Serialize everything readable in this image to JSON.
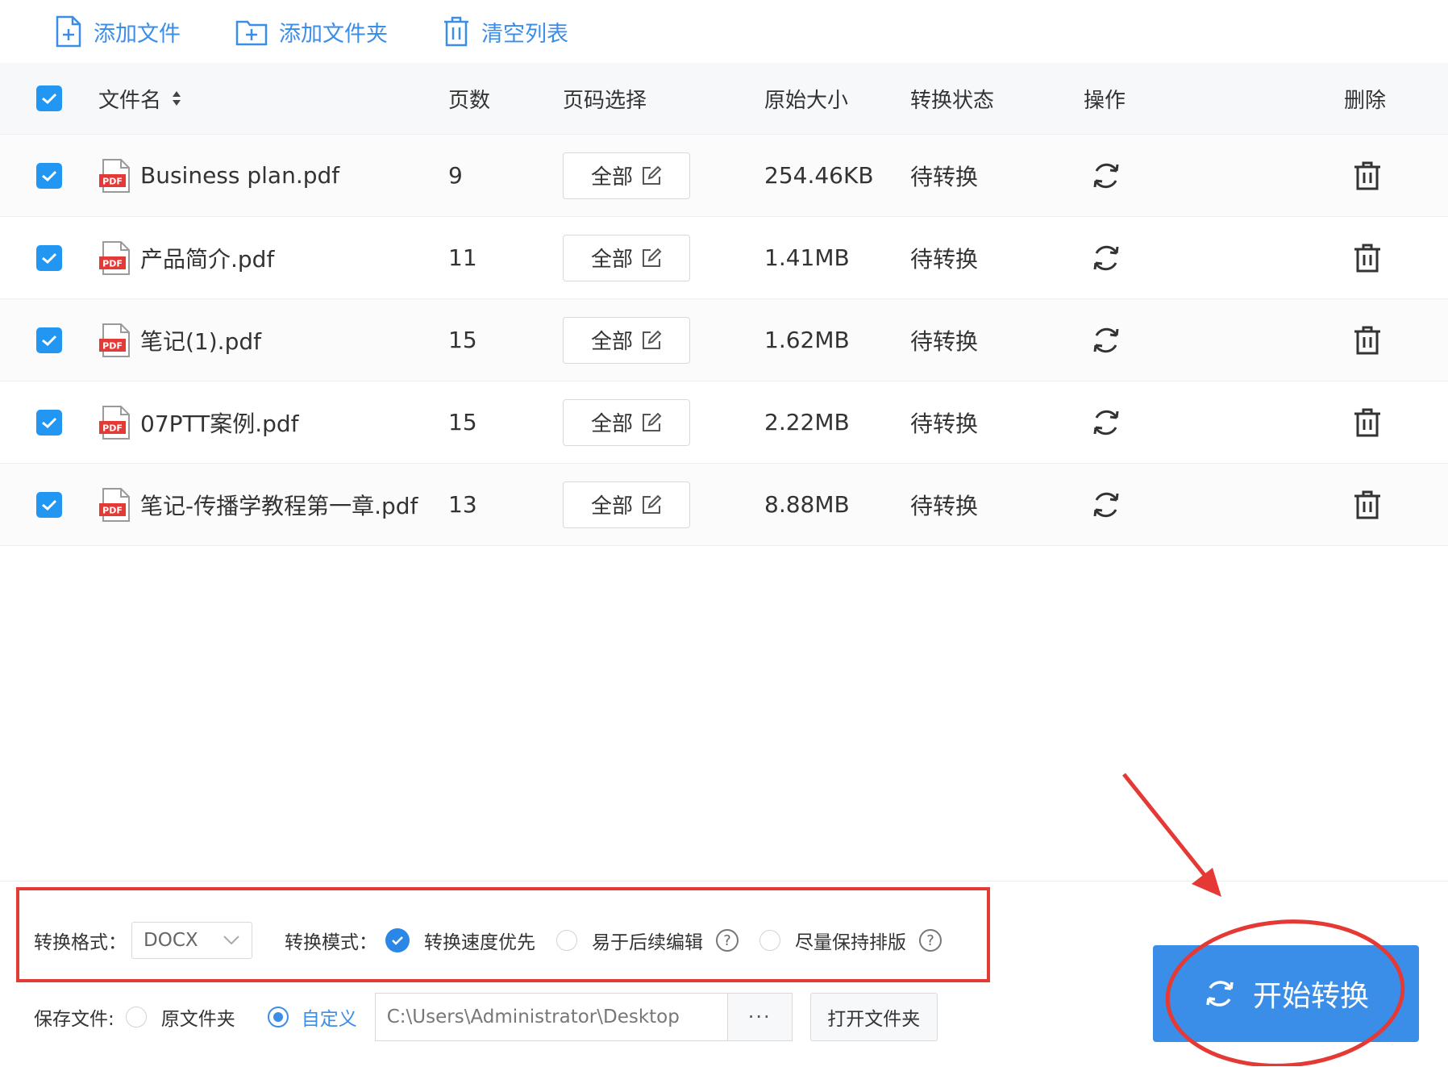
{
  "toolbar": {
    "add_file": "添加文件",
    "add_folder": "添加文件夹",
    "clear_list": "清空列表"
  },
  "table": {
    "headers": {
      "filename": "文件名",
      "pages": "页数",
      "page_select": "页码选择",
      "size": "原始大小",
      "status": "转换状态",
      "action": "操作",
      "delete": "删除"
    },
    "rows": [
      {
        "name": "Business plan.pdf",
        "pages": "9",
        "range": "全部",
        "size": "254.46KB",
        "status": "待转换"
      },
      {
        "name": "产品简介.pdf",
        "pages": "11",
        "range": "全部",
        "size": "1.41MB",
        "status": "待转换"
      },
      {
        "name": "笔记(1).pdf",
        "pages": "15",
        "range": "全部",
        "size": "1.62MB",
        "status": "待转换"
      },
      {
        "name": "07PTT案例.pdf",
        "pages": "15",
        "range": "全部",
        "size": "2.22MB",
        "status": "待转换"
      },
      {
        "name": "笔记-传播学教程第一章.pdf",
        "pages": "13",
        "range": "全部",
        "size": "8.88MB",
        "status": "待转换"
      }
    ],
    "pdf_badge": "PDF"
  },
  "options": {
    "format_label": "转换格式：",
    "format_value": "DOCX",
    "mode_label": "转换模式：",
    "mode_speed": "转换速度优先",
    "mode_edit": "易于后续编辑",
    "mode_layout": "尽量保持排版",
    "help": "?"
  },
  "save": {
    "label": "保存文件:",
    "original": "原文件夹",
    "custom": "自定义",
    "path": "C:\\Users\\Administrator\\Desktop",
    "browse": "···",
    "open_folder": "打开文件夹"
  },
  "start_label": "开始转换",
  "colors": {
    "accent": "#3b8ee8",
    "annotation": "#e53935"
  }
}
